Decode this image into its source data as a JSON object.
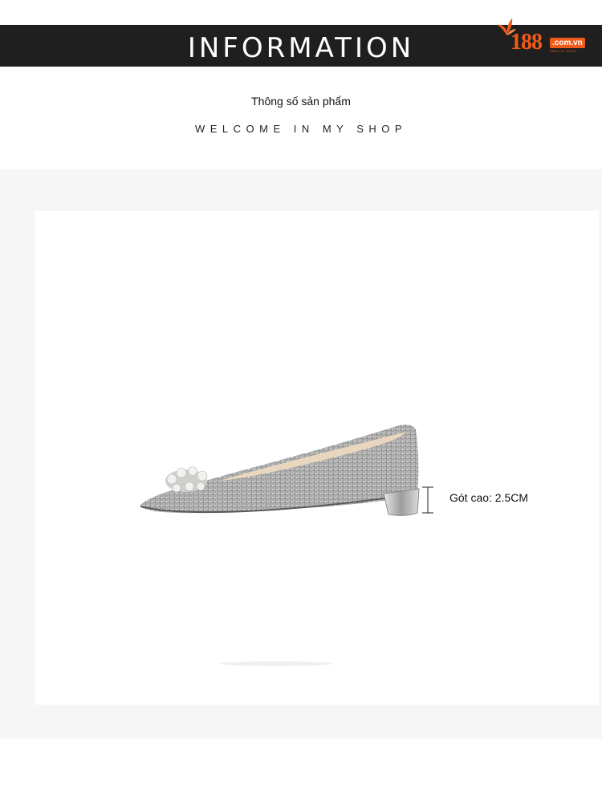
{
  "header": {
    "title": "INFORMATION",
    "logo": {
      "number": "188",
      "domain": ".com.vn",
      "tagline": "SẮM LÀ THÍCH"
    }
  },
  "intro": {
    "subtitle": "Thông số sản phẩm",
    "welcome": "WELCOME IN MY SHOP"
  },
  "product": {
    "image": "silver-glitter-pointed-flat-shoe-with-pearl-rhinestone-buckle",
    "heel_label": "Gót cao: 2.5CM"
  },
  "colors": {
    "banner": "#1f1f1f",
    "brand": "#f05a1a",
    "section_bg": "#f6f6f6"
  }
}
